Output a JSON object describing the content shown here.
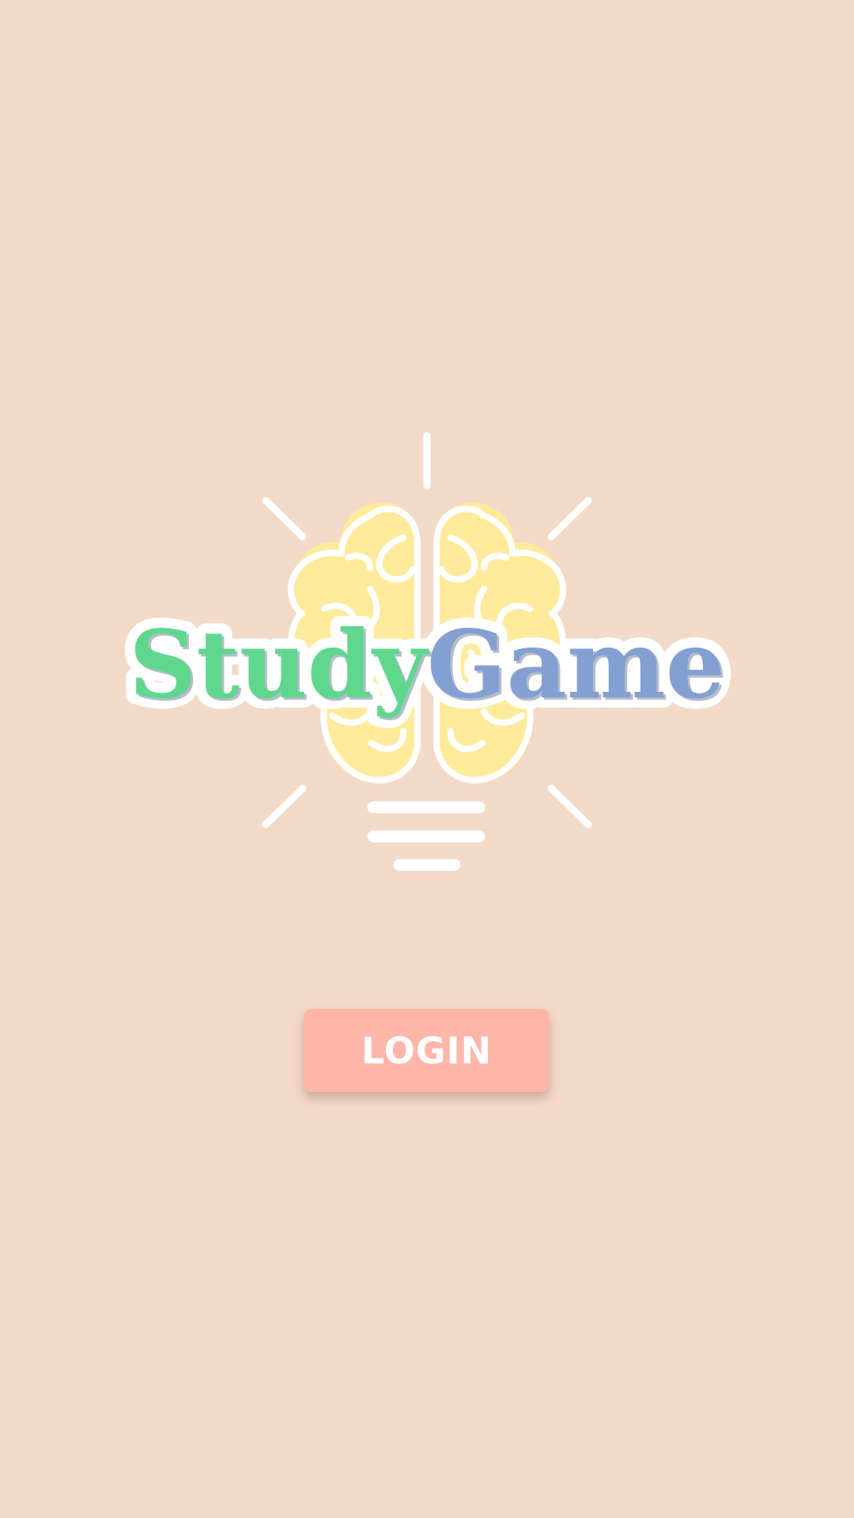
{
  "app": {
    "title_word_1": "Study",
    "title_word_2": "Game",
    "logo_icon": "brain-lightbulb-icon"
  },
  "login": {
    "label": "LOGIN"
  },
  "colors": {
    "background": "#f3d9c8",
    "study_green": "#60d78e",
    "game_blue": "#849fd2",
    "brain_yellow": "#fdeb9b",
    "button_salmon": "#ffb6aa",
    "white": "#ffffff"
  }
}
